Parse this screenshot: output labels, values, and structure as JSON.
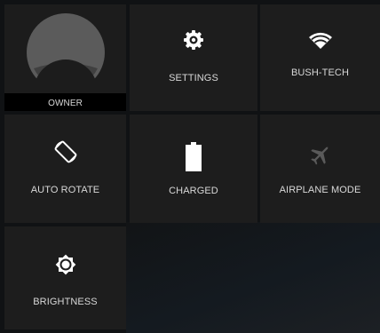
{
  "quick_settings": {
    "owner": {
      "label": "OWNER",
      "icon": "user-avatar-icon"
    },
    "settings": {
      "label": "SETTINGS",
      "icon": "gear-icon"
    },
    "wifi": {
      "label": "BUSH-TECH",
      "icon": "wifi-icon"
    },
    "auto_rotate": {
      "label": "AUTO ROTATE",
      "icon": "rotate-icon"
    },
    "battery": {
      "label": "CHARGED",
      "icon": "battery-full-icon"
    },
    "airplane": {
      "label": "AIRPLANE MODE",
      "icon": "airplane-icon"
    },
    "brightness": {
      "label": "BRIGHTNESS",
      "icon": "brightness-icon"
    }
  },
  "colors": {
    "tile_bg": "#1d1d1d",
    "panel_bg": "#101214",
    "text": "#d8d8d8",
    "icon_active": "#ffffff",
    "icon_inactive": "#5a5a5a",
    "avatar": "#5b5b5b"
  }
}
